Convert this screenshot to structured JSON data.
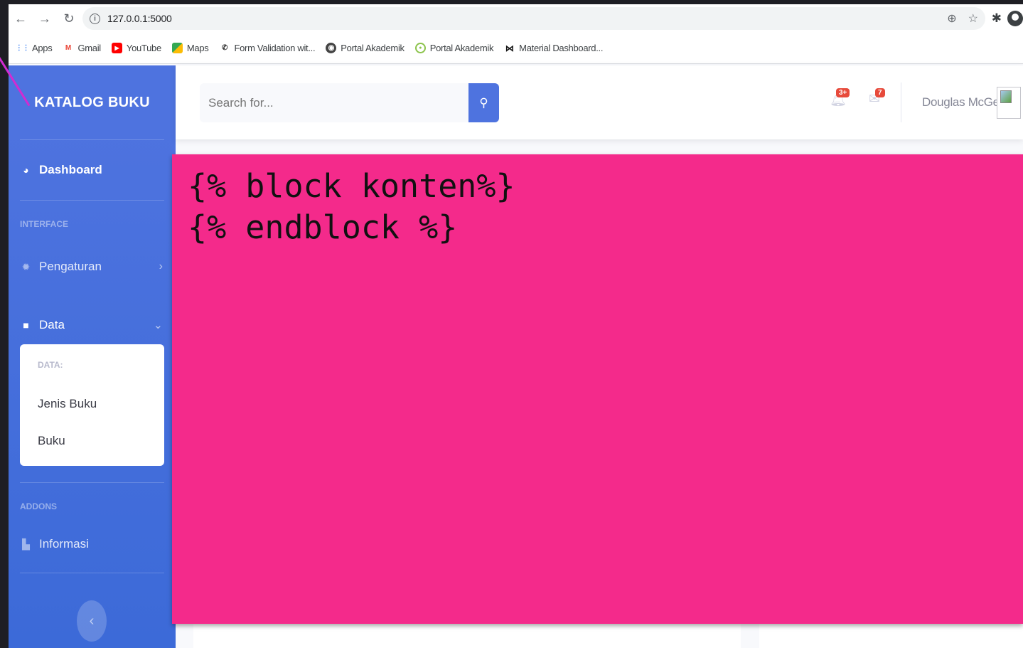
{
  "browser": {
    "url": "127.0.0.1:5000",
    "bookmarks": [
      {
        "label": "Apps",
        "icon": "apps-grid-icon"
      },
      {
        "label": "Gmail",
        "icon": "gmail-icon"
      },
      {
        "label": "YouTube",
        "icon": "youtube-icon"
      },
      {
        "label": "Maps",
        "icon": "maps-icon"
      },
      {
        "label": "Form Validation wit...",
        "icon": "phone-icon"
      },
      {
        "label": "Portal Akademik",
        "icon": "globe-icon"
      },
      {
        "label": "Portal Akademik",
        "icon": "circle-logo-icon"
      },
      {
        "label": "Material Dashboard...",
        "icon": "bowtie-icon"
      }
    ]
  },
  "sidebar": {
    "brand": "KATALOG BUKU",
    "dashboard": "Dashboard",
    "heading_interface": "INTERFACE",
    "pengaturan": "Pengaturan",
    "data": "Data",
    "collapse_heading": "DATA:",
    "collapse_items": [
      "Jenis Buku",
      "Buku"
    ],
    "heading_addons": "ADDONS",
    "informasi": "Informasi"
  },
  "topbar": {
    "search_placeholder": "Search for...",
    "alerts_badge": "3+",
    "messages_badge": "7",
    "username": "Douglas McGee"
  },
  "content": {
    "line1": "{% block konten%}",
    "line2": "{% endblock %}"
  },
  "colors": {
    "sidebar": "#4e73df",
    "overlay": "#f42a8b",
    "badge": "#e74a3b"
  }
}
